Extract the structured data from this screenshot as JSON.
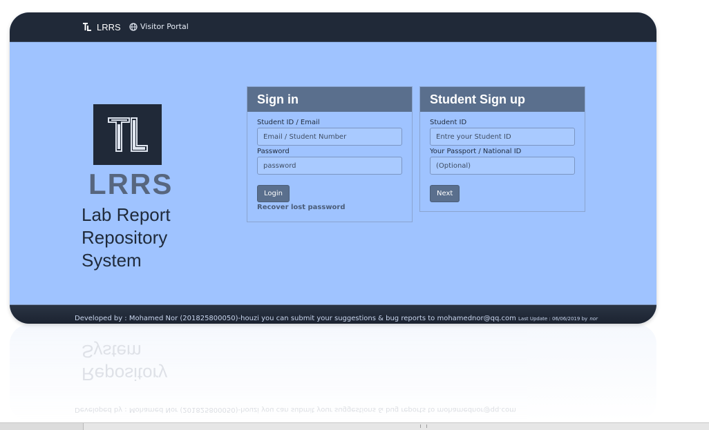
{
  "navbar": {
    "brand": "LRRS",
    "link_label": "Visitor Portal"
  },
  "branding": {
    "abbr": "LRRS",
    "name_lines": [
      "Lab Report",
      "Repository",
      "System"
    ]
  },
  "signin": {
    "title": "Sign in",
    "id_label": "Student ID / Email",
    "id_placeholder": "Email / Student Number",
    "password_label": "Password",
    "password_placeholder": "password",
    "login_button": "Login",
    "recover_link": "Recover lost password"
  },
  "signup": {
    "title": "Student Sign up",
    "id_label": "Student ID",
    "id_placeholder": "Entre your Student ID",
    "passport_label": "Your Passport / National ID",
    "passport_placeholder": "(Optional)",
    "next_button": "Next"
  },
  "footer": {
    "text": "Developed by : Mohamed Nor (201825800050)-houzi you can submit your suggestions & bug reports to mohamednor@qq.com",
    "last_update": "Last Update : 06/06/2019 by",
    "by_name": "nor"
  },
  "icons": {
    "brand": "lrrs-logo-icon",
    "nav_link": "globe-icon"
  },
  "colors": {
    "navbar": "#202938",
    "page_bg": "#9fc3ff",
    "panel_header": "#5a6f8d",
    "logo_text": "#57667e"
  }
}
